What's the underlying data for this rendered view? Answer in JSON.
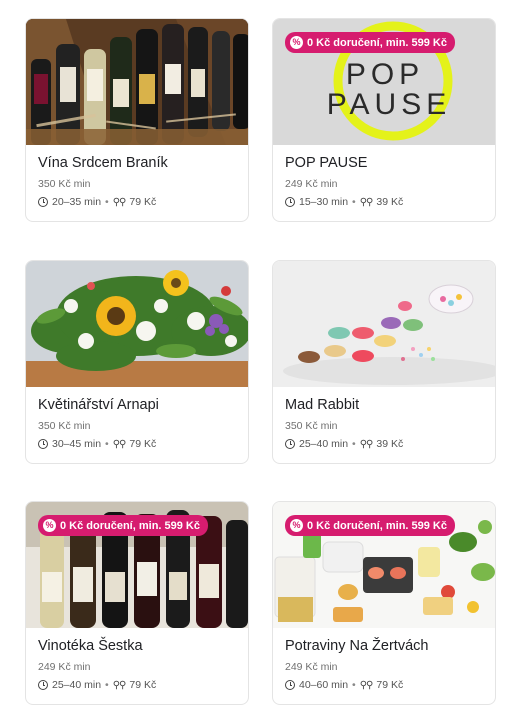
{
  "restaurants": [
    {
      "name": "Vína Srdcem Braník",
      "min_order": "350 Kč min",
      "delivery_time": "20–35 min",
      "delivery_fee": "79 Kč",
      "badge": ""
    },
    {
      "name": "POP PAUSE",
      "min_order": "249 Kč min",
      "delivery_time": "15–30 min",
      "delivery_fee": "39 Kč",
      "badge": "0 Kč doručení, min. 599 Kč",
      "logo_text_1": "POP",
      "logo_text_2": "PAUSE"
    },
    {
      "name": "Květinářství Arnapi",
      "min_order": "350 Kč min",
      "delivery_time": "30–45 min",
      "delivery_fee": "79 Kč",
      "badge": ""
    },
    {
      "name": "Mad Rabbit",
      "min_order": "350 Kč min",
      "delivery_time": "25–40 min",
      "delivery_fee": "39 Kč",
      "badge": ""
    },
    {
      "name": "Vinotéka Šestka",
      "min_order": "249 Kč min",
      "delivery_time": "25–40 min",
      "delivery_fee": "79 Kč",
      "badge": "0 Kč doručení, min. 599 Kč"
    },
    {
      "name": "Potraviny Na Žertvách",
      "min_order": "249 Kč min",
      "delivery_time": "40–60 min",
      "delivery_fee": "79 Kč",
      "badge": "0 Kč doručení, min. 599 Kč"
    }
  ],
  "separator": "•",
  "colors": {
    "badge": "#d61c6f",
    "pop_logo_yellow": "#e4f21a"
  },
  "icons": {
    "badge": "percent-icon",
    "time": "clock-icon",
    "fee": "bike-icon"
  }
}
